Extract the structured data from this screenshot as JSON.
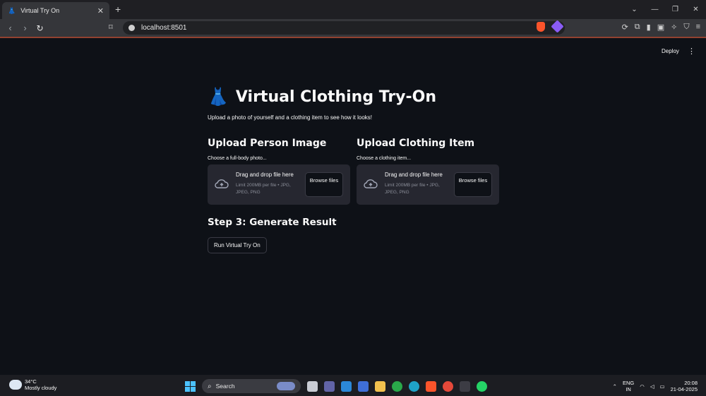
{
  "browser": {
    "tab_title": "Virtual Try On",
    "tab_icon": "👗",
    "close_glyph": "✕",
    "new_tab_glyph": "+",
    "url": "localhost:8501"
  },
  "app": {
    "deploy_label": "Deploy",
    "title": "Virtual Clothing Try-On",
    "title_icon": "👗",
    "subtitle": "Upload a photo of yourself and a clothing item to see how it looks!",
    "person_section": {
      "heading": "Upload Person Image",
      "hint": "Choose a full-body photo...",
      "drop_text": "Drag and drop file here",
      "limit_text": "Limit 200MB per file • JPG, JPEG, PNG",
      "browse_label": "Browse files"
    },
    "clothing_section": {
      "heading": "Upload Clothing Item",
      "hint": "Choose a clothing item...",
      "drop_text": "Drag and drop file here",
      "limit_text": "Limit 200MB per file • JPG, JPEG, PNG",
      "browse_label": "Browse files"
    },
    "step3_heading": "Step 3: Generate Result",
    "run_button_label": "Run Virtual Try On"
  },
  "taskbar": {
    "temperature": "34°C",
    "weather": "Mostly cloudy",
    "search_label": "Search",
    "lang_line1": "ENG",
    "lang_line2": "IN",
    "time": "20:08",
    "date": "21-04-2025"
  },
  "colors": {
    "background": "#0e1117",
    "uploader_bg": "#262730",
    "text": "#fafafa",
    "muted_text": "#8b8e99"
  }
}
